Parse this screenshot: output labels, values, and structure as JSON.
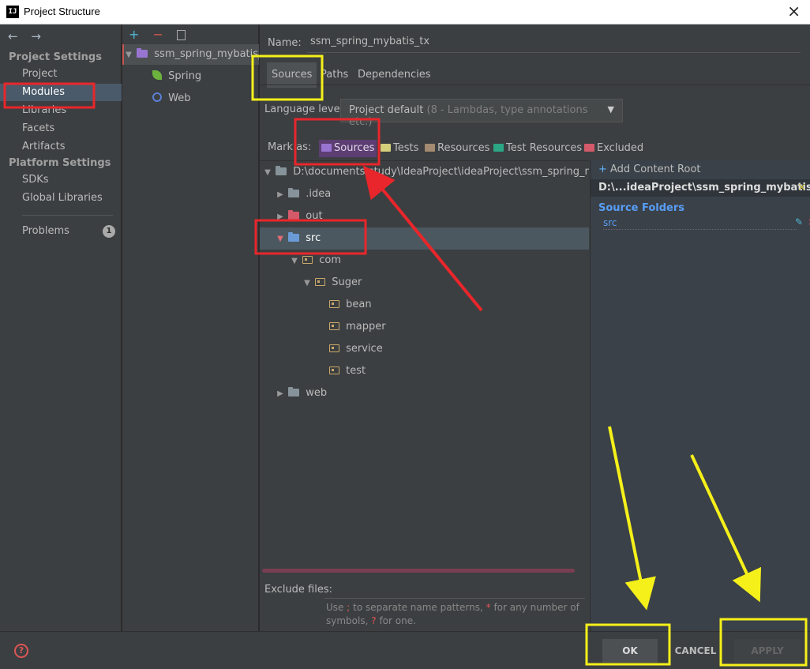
{
  "window": {
    "title": "Project Structure"
  },
  "sidebar": {
    "project_settings": "Project Settings",
    "items1": [
      "Project",
      "Modules",
      "Libraries",
      "Facets",
      "Artifacts"
    ],
    "platform_settings": "Platform Settings",
    "items2": [
      "SDKs",
      "Global Libraries"
    ],
    "problems": "Problems",
    "problems_count": "1"
  },
  "modules": {
    "module_name": "ssm_spring_mybatis_tx",
    "facets": [
      "Spring",
      "Web"
    ]
  },
  "main": {
    "name_label": "Name:",
    "name_value": "ssm_spring_mybatis_tx",
    "tabs": [
      "Sources",
      "Paths",
      "Dependencies"
    ],
    "language_label": "Language level:",
    "language_value": "Project default",
    "language_hint": "(8 - Lambdas, type annotations etc.)",
    "mark_as": "Mark as:",
    "marks": [
      "Sources",
      "Tests",
      "Resources",
      "Test Resources",
      "Excluded"
    ],
    "mark_colors": [
      "#9875d1",
      "#d4cf7a",
      "#a48a70",
      "#2aa784",
      "#d45a6a"
    ]
  },
  "tree": {
    "root": "D:\\documents\\study\\IdeaProject\\ideaProject\\ssm_spring_mybatis",
    "idea": ".idea",
    "out": "out",
    "src": "src",
    "com": "com",
    "suger": "Suger",
    "bean": "bean",
    "mapper": "mapper",
    "service": "service",
    "test": "test",
    "web": "web"
  },
  "right": {
    "add_root": "Add Content Root",
    "root_path": "D:\\...ideaProject\\ssm_spring_mybatis_tx",
    "source_folders": "Source Folders",
    "src": "src"
  },
  "exclude": {
    "label": "Exclude files:",
    "hint1": "Use",
    "hint_sep": ";",
    "hint2": "to separate name patterns,",
    "hint_star": "*",
    "hint3": "for any number of symbols,",
    "hint_q": "?",
    "hint4": "for one."
  },
  "buttons": {
    "ok": "OK",
    "cancel": "CANCEL",
    "apply": "APPLY"
  },
  "icons": {
    "help": "?",
    "close": "×",
    "back": "←",
    "forward": "→",
    "add": "+",
    "remove": "−"
  }
}
